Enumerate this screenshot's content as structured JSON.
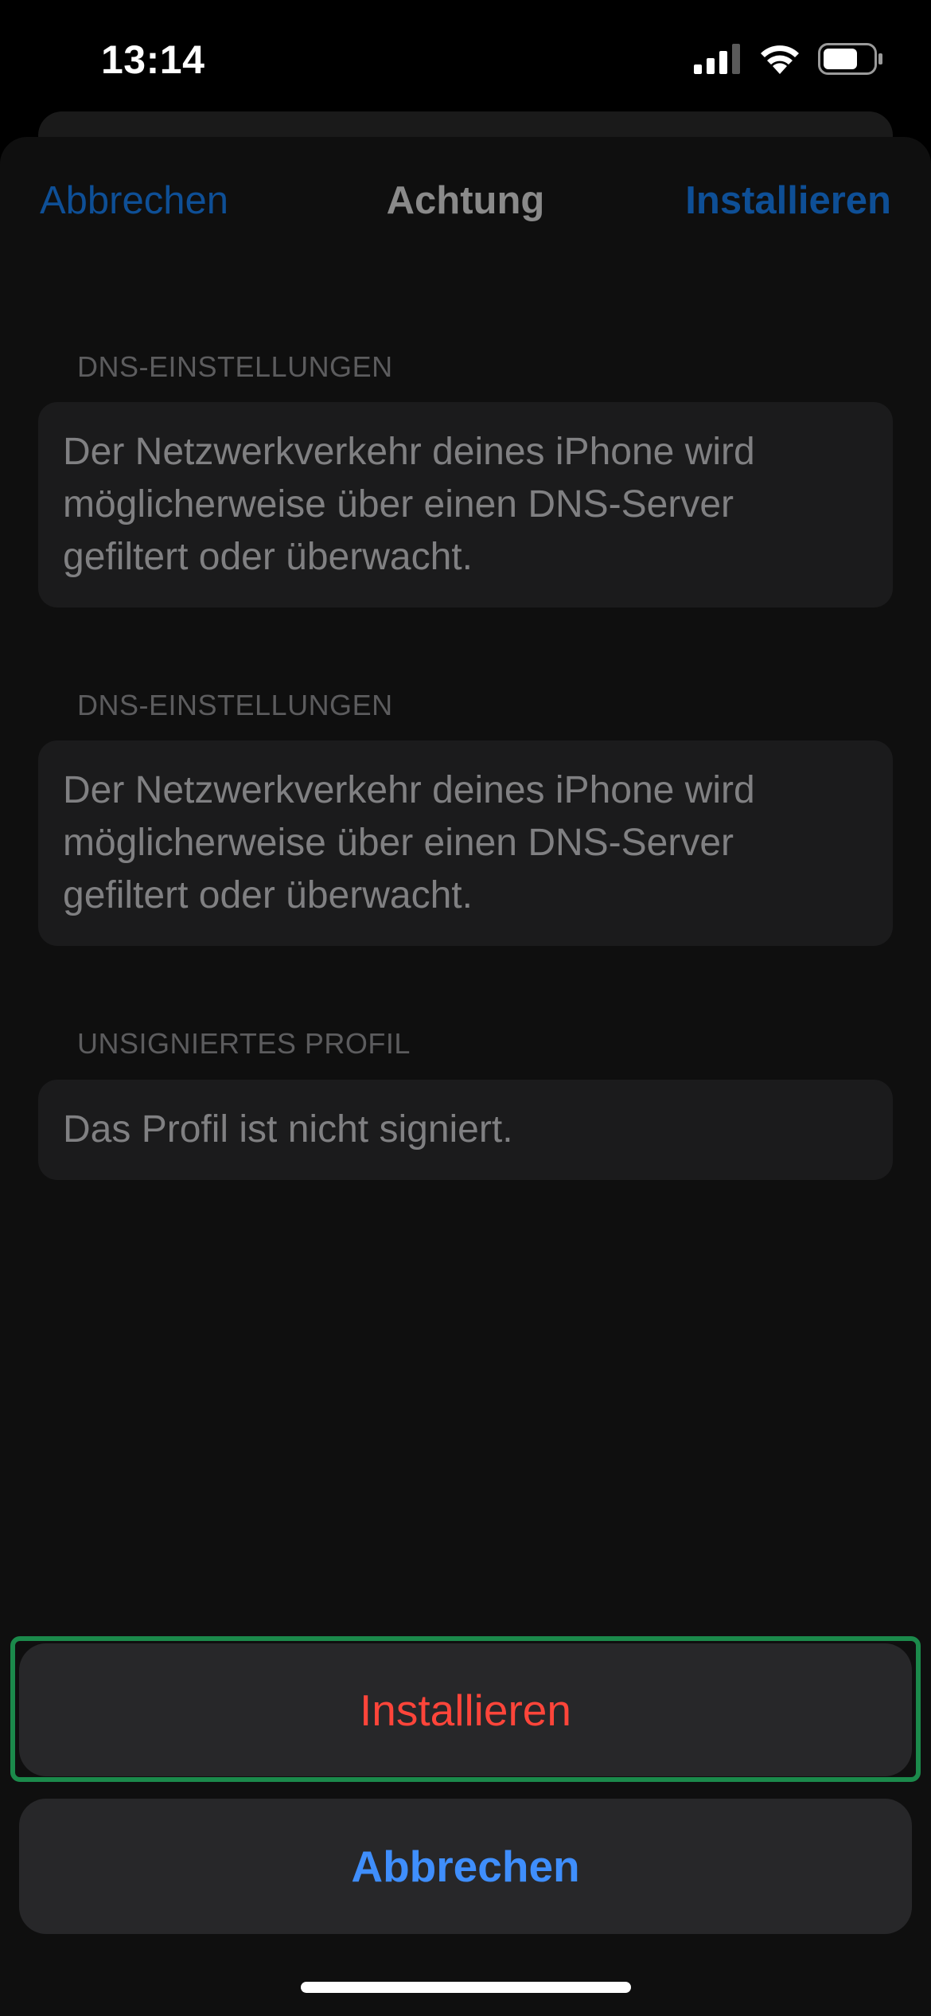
{
  "status_bar": {
    "time": "13:14",
    "icons": [
      "cellular-signal-icon",
      "wifi-icon",
      "battery-icon"
    ]
  },
  "nav": {
    "cancel_label": "Abbrechen",
    "title": "Achtung",
    "install_label": "Installieren"
  },
  "sections": [
    {
      "header": "DNS-EINSTELLUNGEN",
      "body": "Der Netzwerkverkehr deines iPhone wird möglicherweise über einen DNS-Server gefiltert oder überwacht."
    },
    {
      "header": "DNS-EINSTELLUNGEN",
      "body": "Der Netzwerkverkehr deines iPhone wird möglicherweise über einen DNS-Server gefiltert oder überwacht."
    },
    {
      "header": "UNSIGNIERTES PROFIL",
      "body": "Das Profil ist nicht signiert."
    }
  ],
  "action_sheet": {
    "install_label": "Installieren",
    "cancel_label": "Abbrechen"
  },
  "colors": {
    "destructive": "#ff453a",
    "link": "#3f8efc",
    "dimmed_link": "#0e4f96",
    "highlight_frame": "#1b8a4b"
  }
}
